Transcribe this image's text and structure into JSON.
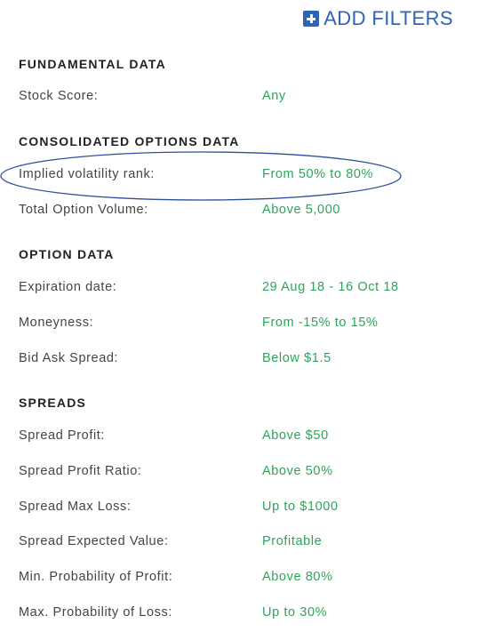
{
  "header": {
    "add_filters_label": "ADD FILTERS",
    "icon": "plus-square-icon",
    "accent_color": "#2e64b8"
  },
  "value_color": "#2ea45a",
  "highlight_color": "#2b4f9a",
  "sections": [
    {
      "title": "FUNDAMENTAL DATA",
      "rows": [
        {
          "label": "Stock Score:",
          "value": "Any"
        }
      ]
    },
    {
      "title": "CONSOLIDATED OPTIONS DATA",
      "rows": [
        {
          "label": "Implied volatility rank:",
          "value": "From 50% to 80%",
          "circled": true
        },
        {
          "label": "Total Option Volume:",
          "value": "Above 5,000"
        }
      ]
    },
    {
      "title": "OPTION DATA",
      "rows": [
        {
          "label": "Expiration date:",
          "value": "29 Aug 18 - 16 Oct 18"
        },
        {
          "label": "Moneyness:",
          "value": "From -15% to 15%"
        },
        {
          "label": "Bid Ask Spread:",
          "value": "Below $1.5"
        }
      ]
    },
    {
      "title": "SPREADS",
      "rows": [
        {
          "label": "Spread Profit:",
          "value": "Above $50"
        },
        {
          "label": "Spread Profit Ratio:",
          "value": "Above 50%"
        },
        {
          "label": "Spread Max Loss:",
          "value": "Up to $1000"
        },
        {
          "label": "Spread Expected Value:",
          "value": "Profitable"
        },
        {
          "label": "Min. Probability of Profit:",
          "value": "Above 80%"
        },
        {
          "label": "Max. Probability of Loss:",
          "value": "Up to 30%"
        }
      ]
    }
  ]
}
